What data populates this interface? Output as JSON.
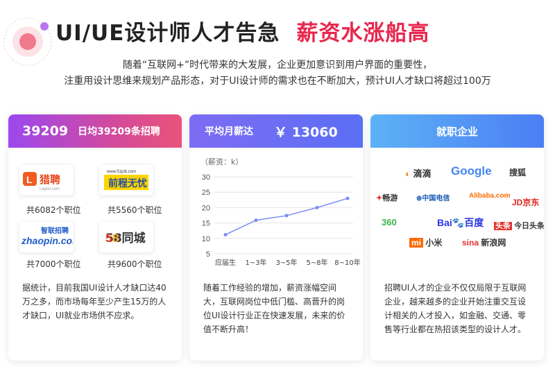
{
  "header": {
    "title_main": "UI/UE设计师人才告急",
    "title_accent": "薪资水涨船高",
    "subtitle_line1": "随着“互联网+”时代带来的大发展，企业更加意识到用户界面的重要性，",
    "subtitle_line2": "注重用设计思维来规划产品形态，对于UI设计师的需求也在不断加大，预计UI人才缺口将超过100万"
  },
  "card1": {
    "head_number": "39209",
    "head_text": "日均39209条招聘",
    "logos": [
      {
        "name": "猎聘",
        "sub": "Liepin.com",
        "caption": "共6082个职位"
      },
      {
        "name": "前程无忧",
        "sub": "www.51job.com",
        "caption": "共5560个职位"
      },
      {
        "name": "智联招聘",
        "sub": "zhaopin.com",
        "caption": "共7000个职位"
      },
      {
        "name": "58同城",
        "sub": "",
        "caption": "共9600个职位"
      }
    ],
    "description": "据统计，目前我国UI设计人才缺口达40万之多，而市场每年至少产生15万的人才缺口，UI就业市场供不应求。"
  },
  "card2": {
    "head_label": "平均月薪达",
    "head_value": "￥ 13060",
    "description": "随着工作经验的增加，薪资涨幅空间大，互联网岗位中低门槛、高晋升的岗位UI设计行业正在快速发展，未来的价值不断升高！"
  },
  "chart_data": {
    "type": "line",
    "ylabel": "（薪资：k）",
    "categories": [
      "应届生",
      "1~3年",
      "3~5年",
      "5~8年",
      "8~10年"
    ],
    "values": [
      11.2,
      15.9,
      17.4,
      20.0,
      23.0
    ],
    "ylim": [
      5,
      30
    ],
    "yticks": [
      "5",
      "10",
      "15",
      "20",
      "25",
      "30"
    ],
    "grid": true,
    "color": "#7b8cf5"
  },
  "card3": {
    "head_text": "就职企业",
    "brands": [
      "滴滴",
      "Google",
      "搜狐",
      "畅游",
      "中国电信",
      "Alibaba.com",
      "京东",
      "360",
      "百度",
      "今日头条",
      "小米",
      "新浪网"
    ],
    "description": "招聘UI人才的企业不仅仅局限于互联网企业，越来越多的企业开始注重交互设计相关的人才投入，如金融、交通、零售等行业都在热招该类型的设计人才。"
  }
}
